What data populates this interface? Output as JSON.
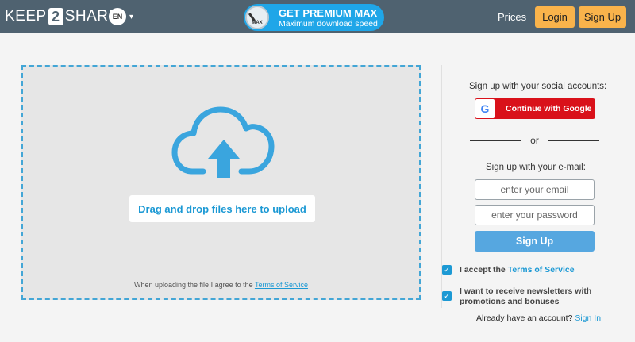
{
  "header": {
    "logo_left": "KEEP",
    "logo_mid": "2",
    "logo_right": "SHARE",
    "lang": "EN",
    "premium_title": "GET PREMIUM MAX",
    "premium_subtitle": "Maximum download speed",
    "premium_badge": "MAX",
    "prices": "Prices",
    "login": "Login",
    "signup": "Sign Up",
    "bg_color": "#4f6270",
    "accent": "#f9b34b"
  },
  "upload": {
    "drag_label": "Drag and drop files here to upload",
    "note_prefix": "When uploading the file I agree to the",
    "note_link": "Terms of Service",
    "icon": "cloud-upload-icon"
  },
  "signup_panel": {
    "social_title": "Sign up with your social accounts:",
    "google_label": "Continue with Google",
    "google_icon": "G",
    "or": "or",
    "email_title": "Sign up with your e-mail:",
    "email_placeholder": "enter your email",
    "password_placeholder": "enter your password",
    "signup_button": "Sign Up",
    "accept_prefix": "I accept the",
    "accept_link": "Terms of Service",
    "newsletter": "I want to receive newsletters with promotions and bonuses",
    "have_account": "Already have an account?",
    "sign_in": "Sign In"
  }
}
